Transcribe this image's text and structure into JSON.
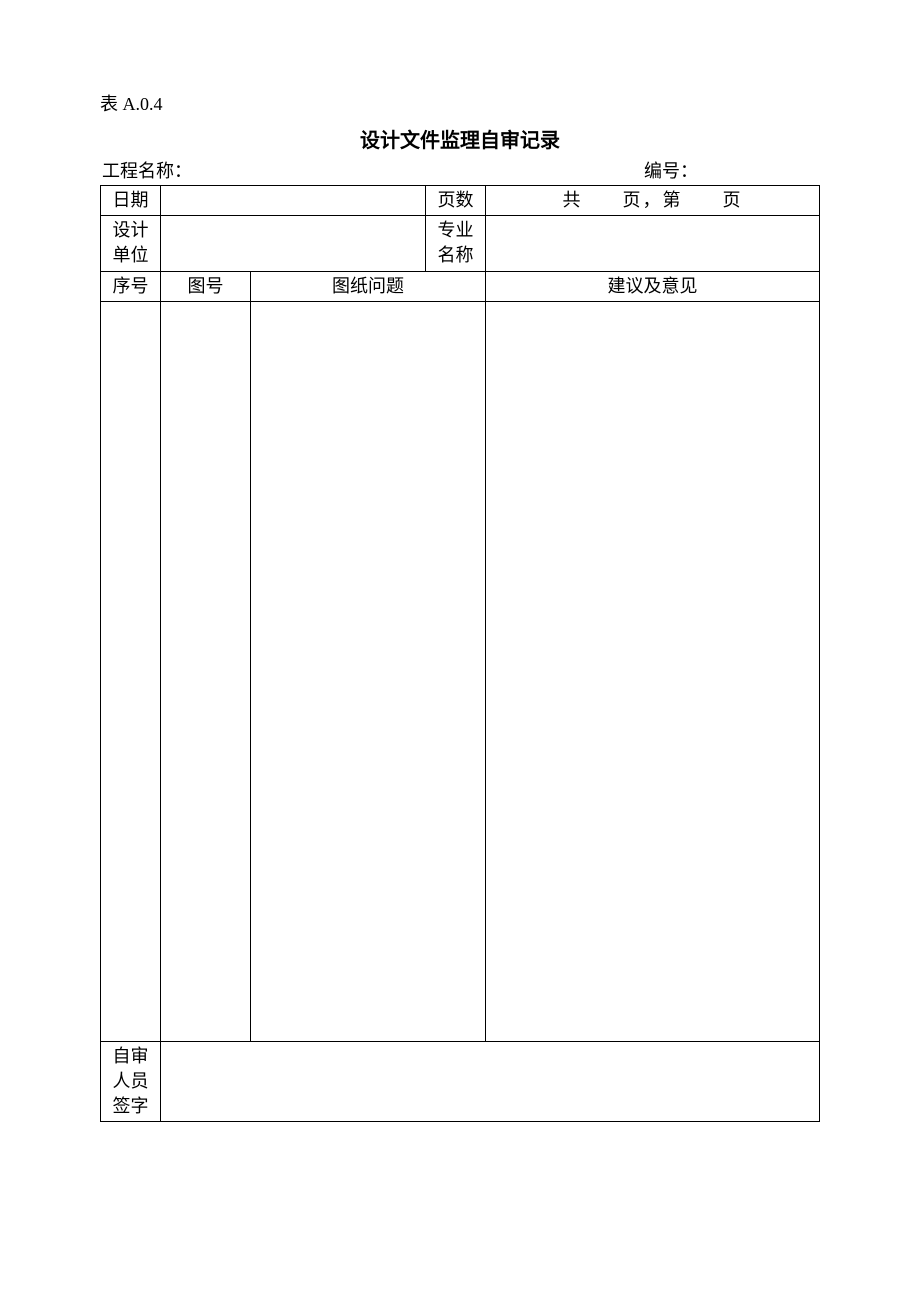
{
  "tableNumber": "表 A.0.4",
  "title": "设计文件监理自审记录",
  "meta": {
    "projectLabel": "工程名称：",
    "projectValue": "",
    "codeLabel": "编号：",
    "codeValue": ""
  },
  "row1": {
    "dateLabel": "日期",
    "dateValue": "",
    "pagesLabel": "页数",
    "pagesText": "共　　页，第　　页"
  },
  "row2": {
    "designUnitLabel": "设计\n单位",
    "designUnitValue": "",
    "specialtyLabel": "专业\n名称",
    "specialtyValue": ""
  },
  "headers": {
    "seq": "序号",
    "drawingNo": "图号",
    "drawingIssue": "图纸问题",
    "suggestion": "建议及意见"
  },
  "bodyRow": {
    "seq": "",
    "drawingNo": "",
    "drawingIssue": "",
    "suggestion": ""
  },
  "signRow": {
    "label": "自审\n人员\n签字",
    "value": ""
  }
}
